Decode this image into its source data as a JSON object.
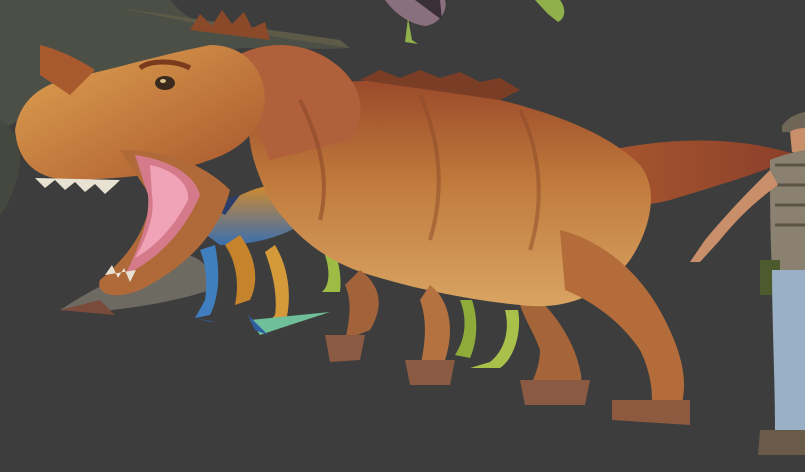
{
  "scene": {
    "background_color": "#3d3d3d",
    "subjects": [
      {
        "name": "carnivore-dinosaur",
        "colors": [
          "#c97a3a",
          "#8c4a2a",
          "#e4b06a",
          "#b4565a"
        ]
      },
      {
        "name": "small-striped-raptor",
        "colors": [
          "#c9862e",
          "#2f5fa3",
          "#6fbf9a"
        ]
      },
      {
        "name": "green-dinosaur-legs",
        "colors": [
          "#a9c04a",
          "#7d9a2e"
        ]
      },
      {
        "name": "gray-dinosaur-background",
        "colors": [
          "#4f5246",
          "#5e5f55"
        ]
      },
      {
        "name": "bird-creature",
        "colors": [
          "#8f7a8a",
          "#3a3036",
          "#8fb04a"
        ]
      },
      {
        "name": "human-explorer",
        "colors": [
          "#6f6657",
          "#9ab0c6",
          "#c98f6a",
          "#4c5a2d"
        ]
      }
    ]
  }
}
